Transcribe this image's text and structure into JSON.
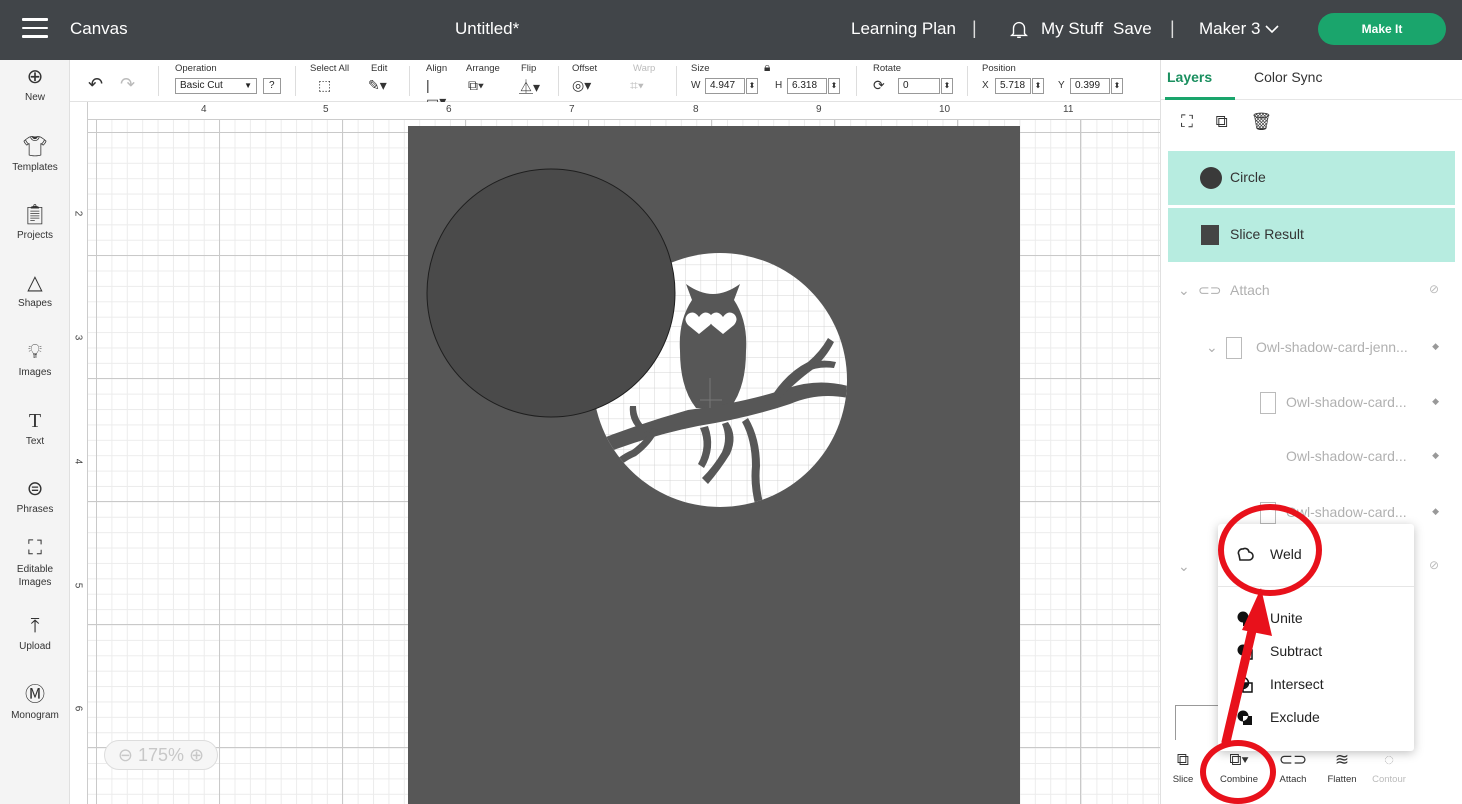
{
  "topbar": {
    "app_title": "Canvas",
    "doc_title": "Untitled*",
    "learning_plan": "Learning Plan",
    "separator": "|",
    "my_stuff": "My Stuff",
    "save": "Save",
    "machine": "Maker 3",
    "make_it": "Make It"
  },
  "toolbar": {
    "operation_label": "Operation",
    "operation_value": "Basic Cut",
    "operation_help": "?",
    "select_all_label": "Select All",
    "edit_label": "Edit",
    "align_label": "Align",
    "arrange_label": "Arrange",
    "flip_label": "Flip",
    "offset_label": "Offset",
    "warp_label": "Warp",
    "size_label": "Size",
    "width_prefix": "W",
    "width_value": "4.947",
    "height_prefix": "H",
    "height_value": "6.318",
    "rotate_label": "Rotate",
    "rotate_value": "0",
    "position_label": "Position",
    "x_prefix": "X",
    "x_value": "5.718",
    "y_prefix": "Y",
    "y_value": "0.399"
  },
  "leftbar": {
    "items": [
      {
        "label": "New",
        "icon": "plus-circle-icon"
      },
      {
        "label": "Templates",
        "icon": "shirt-icon"
      },
      {
        "label": "Projects",
        "icon": "clipboard-icon"
      },
      {
        "label": "Shapes",
        "icon": "shapes-icon"
      },
      {
        "label": "Images",
        "icon": "lightbulb-icon"
      },
      {
        "label": "Text",
        "icon": "text-icon"
      },
      {
        "label": "Phrases",
        "icon": "speech-bubble-icon"
      },
      {
        "label": "Editable Images",
        "icon": "editable-image-icon"
      },
      {
        "label": "Upload",
        "icon": "upload-icon"
      },
      {
        "label": "Monogram",
        "icon": "monogram-icon"
      }
    ]
  },
  "canvas": {
    "ruler_top": [
      "4",
      "5",
      "6",
      "7",
      "8",
      "9",
      "10",
      "11"
    ],
    "ruler_left": [
      "2",
      "3",
      "4",
      "5",
      "6"
    ],
    "zoom": "175%",
    "card_color": "#575757",
    "circle_color": "#4a4a4a"
  },
  "rightpanel": {
    "tabs": [
      "Layers",
      "Color Sync"
    ],
    "layers": [
      {
        "name": "Circle",
        "selected": true
      },
      {
        "name": "Slice Result",
        "selected": true
      },
      {
        "name": "Attach",
        "selected": false
      },
      {
        "name": "Owl-shadow-card-jenn...",
        "selected": false
      },
      {
        "name": "Owl-shadow-card...",
        "selected": false
      },
      {
        "name": "Owl-shadow-card...",
        "selected": false
      },
      {
        "name": "Owl-shadow-card...",
        "selected": false
      }
    ],
    "bottom_tools": [
      "Slice",
      "Combine",
      "Attach",
      "Flatten",
      "Contour"
    ]
  },
  "combine_menu": {
    "items": [
      "Weld",
      "Unite",
      "Subtract",
      "Intersect",
      "Exclude"
    ]
  },
  "colors": {
    "accent": "#1aa56c",
    "topbar": "#414549",
    "selected_layer": "#b7ece0",
    "annotation": "#e8111b"
  }
}
